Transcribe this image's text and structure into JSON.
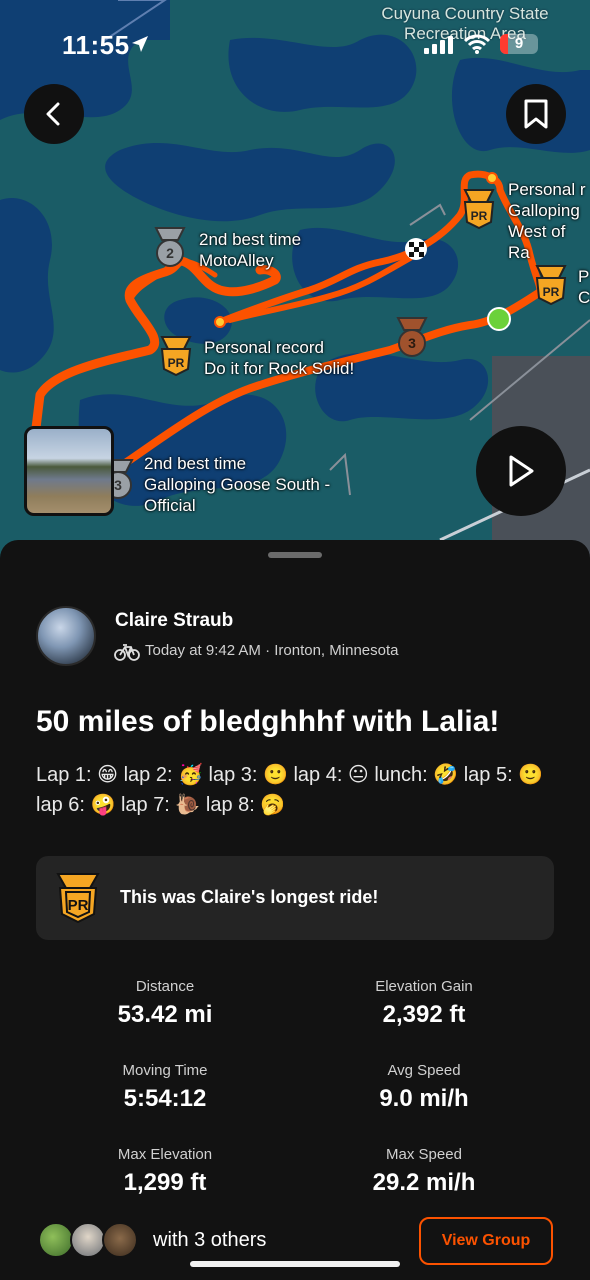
{
  "status_bar": {
    "time": "11:55",
    "battery_level": "9",
    "battery_color": "#ff3b30"
  },
  "map": {
    "park_label": "Cuyuna Country State Recreation Area",
    "segments": [
      {
        "line1": "2nd best time",
        "line2": "MotoAlley",
        "badge": "2"
      },
      {
        "line1": "Personal record",
        "line2": "Do it for Rock Solid!",
        "badge": "PR"
      },
      {
        "line1": "2nd best time",
        "line2": "Galloping Goose South -",
        "line3": "Official",
        "badge": "3"
      },
      {
        "line1": "Personal r",
        "line2": "Galloping",
        "line3": "West of Ra",
        "badge": "PR"
      },
      {
        "line1": "P",
        "line2": "C",
        "badge": "PR"
      }
    ],
    "third_badge": "3",
    "route_color": "#fc5200"
  },
  "activity": {
    "athlete": "Claire Straub",
    "meta": "Today at 9:42 AM · Ironton, Minnesota",
    "title": "50 miles of bledghhhf with Lalia!",
    "description": "Lap 1: 😁 lap 2: 🥳 lap 3: 🙂 lap 4: 😐 lunch: 🤣 lap 5: 🙂 lap 6: 🤪 lap 7: 🐌 lap 8: 🥱",
    "achievement": "This was Claire's longest ride!",
    "pr_badge": "PR",
    "stats": [
      {
        "label": "Distance",
        "value": "53.42 mi"
      },
      {
        "label": "Elevation Gain",
        "value": "2,392 ft"
      },
      {
        "label": "Moving Time",
        "value": "5:54:12"
      },
      {
        "label": "Avg Speed",
        "value": "9.0 mi/h"
      },
      {
        "label": "Max Elevation",
        "value": "1,299 ft"
      },
      {
        "label": "Max Speed",
        "value": "29.2 mi/h"
      }
    ],
    "group_text": "with 3 others",
    "view_group": "View Group"
  },
  "colors": {
    "accent": "#fc5200",
    "pr_gold": "#f5a623",
    "background": "#121212"
  }
}
